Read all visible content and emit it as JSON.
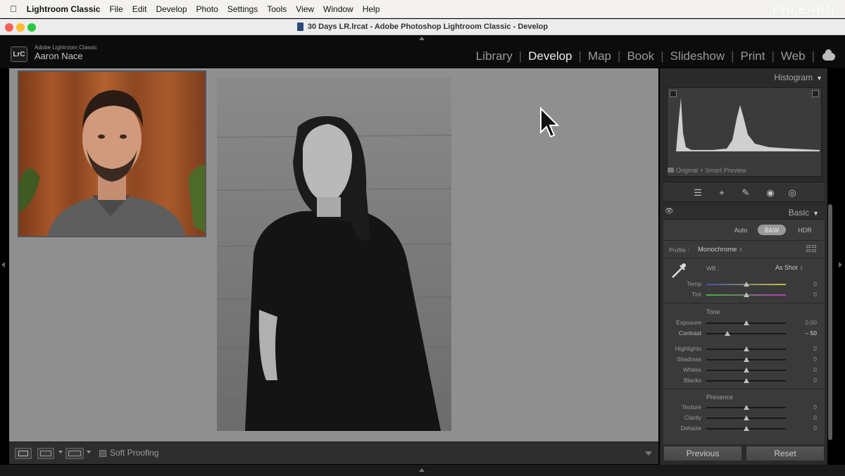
{
  "menubar": {
    "app_name": "Lightroom Classic",
    "items": [
      "File",
      "Edit",
      "Develop",
      "Photo",
      "Settings",
      "Tools",
      "View",
      "Window",
      "Help"
    ],
    "watermark": "PHLEARN"
  },
  "window": {
    "title": "30 Days LR.lrcat - Adobe Photoshop Lightroom Classic - Develop"
  },
  "identity_plate": {
    "logo": "LrC",
    "product": "Adobe Lightroom Classic",
    "user": "Aaron Nace"
  },
  "modules": {
    "items": [
      "Library",
      "Develop",
      "Map",
      "Book",
      "Slideshow",
      "Print",
      "Web"
    ],
    "active": "Develop"
  },
  "toolbar": {
    "soft_proofing_label": "Soft Proofing"
  },
  "histogram": {
    "title": "Histogram",
    "info": "Original + Smart Preview"
  },
  "basic": {
    "title": "Basic",
    "treatments": [
      "Auto",
      "B&W",
      "HDR"
    ],
    "selected_treatment": "B&W",
    "profile_label": "Profile :",
    "profile_value": "Monochrome",
    "wb_label": "WB :",
    "wb_value": "As Shot",
    "temp_label": "Temp",
    "temp_value": "0",
    "tint_label": "Tint",
    "tint_value": "0",
    "tone_title": "Tone",
    "exposure_label": "Exposure",
    "exposure_value": "0.00",
    "contrast_label": "Contrast",
    "contrast_value": "– 50",
    "highlights_label": "Highlights",
    "highlights_value": "0",
    "shadows_label": "Shadows",
    "shadows_value": "0",
    "whites_label": "Whites",
    "whites_value": "0",
    "blacks_label": "Blacks",
    "blacks_value": "0",
    "presence_title": "Presence",
    "texture_label": "Texture",
    "texture_value": "0",
    "clarity_label": "Clarity",
    "clarity_value": "0",
    "dehaze_label": "Dehaze",
    "dehaze_value": "0"
  },
  "buttons": {
    "previous": "Previous",
    "reset": "Reset"
  },
  "colors": {
    "accent_active_module": "#eeeeee",
    "panel_bg": "#2a2a2a",
    "canvas_bg": "#8f8f8f"
  }
}
